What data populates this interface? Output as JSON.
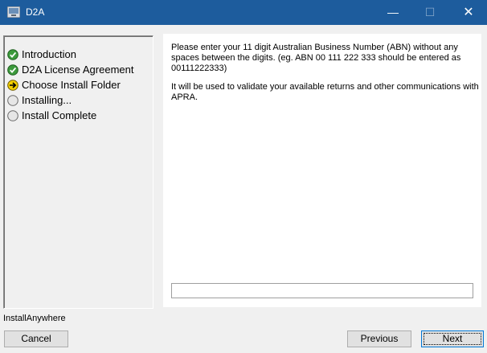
{
  "window": {
    "title": "D2A",
    "minimize_glyph": "—",
    "maximize_glyph": "☐",
    "close_glyph": "✕"
  },
  "steps": [
    {
      "label": "Introduction",
      "status": "complete",
      "icon": "check-circle-icon"
    },
    {
      "label": "D2A License Agreement",
      "status": "complete",
      "icon": "check-circle-icon"
    },
    {
      "label": "Choose Install Folder",
      "status": "current",
      "icon": "arrow-circle-icon"
    },
    {
      "label": "Installing...",
      "status": "pending",
      "icon": "empty-circle-icon"
    },
    {
      "label": "Install Complete",
      "status": "pending",
      "icon": "empty-circle-icon"
    }
  ],
  "content": {
    "paragraph1": "Please enter your 11 digit Australian Business Number (ABN) without any spaces between the digits. (eg. ABN 00 111 222 333 should be entered as 00111222333)",
    "paragraph2": "It will be used to validate your available returns and other communications with APRA.",
    "abn_value": ""
  },
  "footer": {
    "brand": "InstallAnywhere",
    "cancel_label": "Cancel",
    "previous_label": "Previous",
    "next_label": "Next"
  },
  "colors": {
    "titlebar": "#1d5c9d",
    "complete": "#2e8b2e",
    "current": "#f0c800"
  }
}
